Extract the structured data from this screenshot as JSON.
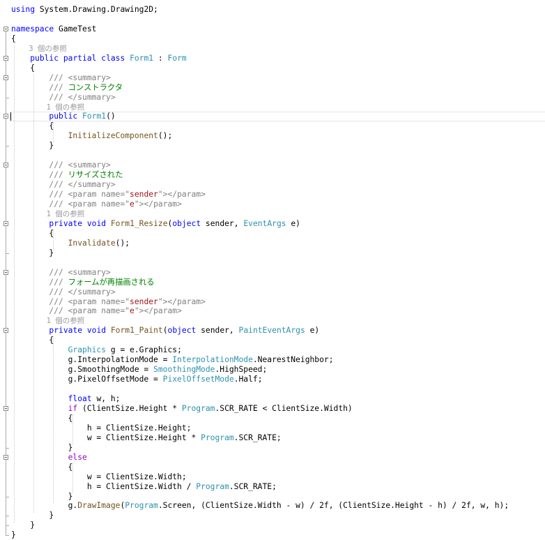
{
  "editor": {
    "lines": [
      [
        {
          "t": "using",
          "c": "kw"
        },
        {
          "t": " System.Drawing.Drawing2D;"
        }
      ],
      [],
      [
        {
          "t": "namespace",
          "c": "kw"
        },
        {
          "t": " GameTest"
        }
      ],
      [
        {
          "t": "{"
        }
      ],
      [
        {
          "t": "    3 個の参照"
        }
      ],
      [
        {
          "t": "    "
        },
        {
          "t": "public",
          "c": "kw"
        },
        {
          "t": " "
        },
        {
          "t": "partial",
          "c": "kw"
        },
        {
          "t": " "
        },
        {
          "t": "class",
          "c": "kw"
        },
        {
          "t": " "
        },
        {
          "t": "Form1",
          "c": "type"
        },
        {
          "t": " : "
        },
        {
          "t": "Form",
          "c": "type"
        }
      ],
      [
        {
          "t": "    {"
        }
      ],
      [
        {
          "t": "        "
        },
        {
          "t": "/// <summary>",
          "c": "xml"
        }
      ],
      [
        {
          "t": "        "
        },
        {
          "t": "///",
          "c": "xml"
        },
        {
          "t": " コンストラクタ",
          "c": "cmt"
        }
      ],
      [
        {
          "t": "        "
        },
        {
          "t": "/// </summary>",
          "c": "xml"
        }
      ],
      [
        {
          "t": "        1 個の参照"
        }
      ],
      [
        {
          "t": "        "
        },
        {
          "t": "public",
          "c": "kw"
        },
        {
          "t": " "
        },
        {
          "t": "Form1",
          "c": "type"
        },
        {
          "t": "()"
        }
      ],
      [
        {
          "t": "        {"
        }
      ],
      [
        {
          "t": "            "
        },
        {
          "t": "InitializeComponent",
          "c": "meth"
        },
        {
          "t": "();"
        }
      ],
      [
        {
          "t": "        }"
        }
      ],
      [],
      [
        {
          "t": "        "
        },
        {
          "t": "/// <summary>",
          "c": "xml"
        }
      ],
      [
        {
          "t": "        "
        },
        {
          "t": "///",
          "c": "xml"
        },
        {
          "t": " リサイズされた",
          "c": "cmt"
        }
      ],
      [
        {
          "t": "        "
        },
        {
          "t": "/// </summary>",
          "c": "xml"
        }
      ],
      [
        {
          "t": "        "
        },
        {
          "t": "/// <param name=\"",
          "c": "xml"
        },
        {
          "t": "sender",
          "c": "str"
        },
        {
          "t": "\"></param>",
          "c": "xml"
        }
      ],
      [
        {
          "t": "        "
        },
        {
          "t": "/// <param name=\"",
          "c": "xml"
        },
        {
          "t": "e",
          "c": "str"
        },
        {
          "t": "\"></param>",
          "c": "xml"
        }
      ],
      [
        {
          "t": "        1 個の参照"
        }
      ],
      [
        {
          "t": "        "
        },
        {
          "t": "private",
          "c": "kw"
        },
        {
          "t": " "
        },
        {
          "t": "void",
          "c": "kw"
        },
        {
          "t": " "
        },
        {
          "t": "Form1_Resize",
          "c": "meth"
        },
        {
          "t": "("
        },
        {
          "t": "object",
          "c": "kw"
        },
        {
          "t": " sender, "
        },
        {
          "t": "EventArgs",
          "c": "type"
        },
        {
          "t": " e)"
        }
      ],
      [
        {
          "t": "        {"
        }
      ],
      [
        {
          "t": "            "
        },
        {
          "t": "Invalidate",
          "c": "meth"
        },
        {
          "t": "();"
        }
      ],
      [
        {
          "t": "        }"
        }
      ],
      [],
      [
        {
          "t": "        "
        },
        {
          "t": "/// <summary>",
          "c": "xml"
        }
      ],
      [
        {
          "t": "        "
        },
        {
          "t": "///",
          "c": "xml"
        },
        {
          "t": " フォームが再描画される",
          "c": "cmt"
        }
      ],
      [
        {
          "t": "        "
        },
        {
          "t": "/// </summary>",
          "c": "xml"
        }
      ],
      [
        {
          "t": "        "
        },
        {
          "t": "/// <param name=\"",
          "c": "xml"
        },
        {
          "t": "sender",
          "c": "str"
        },
        {
          "t": "\"></param>",
          "c": "xml"
        }
      ],
      [
        {
          "t": "        "
        },
        {
          "t": "/// <param name=\"",
          "c": "xml"
        },
        {
          "t": "e",
          "c": "str"
        },
        {
          "t": "\"></param>",
          "c": "xml"
        }
      ],
      [
        {
          "t": "        1 個の参照"
        }
      ],
      [
        {
          "t": "        "
        },
        {
          "t": "private",
          "c": "kw"
        },
        {
          "t": " "
        },
        {
          "t": "void",
          "c": "kw"
        },
        {
          "t": " "
        },
        {
          "t": "Form1_Paint",
          "c": "meth"
        },
        {
          "t": "("
        },
        {
          "t": "object",
          "c": "kw"
        },
        {
          "t": " sender, "
        },
        {
          "t": "PaintEventArgs",
          "c": "type"
        },
        {
          "t": " e)"
        }
      ],
      [
        {
          "t": "        {"
        }
      ],
      [
        {
          "t": "            "
        },
        {
          "t": "Graphics",
          "c": "type"
        },
        {
          "t": " g = e.Graphics;"
        }
      ],
      [
        {
          "t": "            g.InterpolationMode = "
        },
        {
          "t": "InterpolationMode",
          "c": "type"
        },
        {
          "t": ".NearestNeighbor;"
        }
      ],
      [
        {
          "t": "            g.SmoothingMode = "
        },
        {
          "t": "SmoothingMode",
          "c": "type"
        },
        {
          "t": ".HighSpeed;"
        }
      ],
      [
        {
          "t": "            g.PixelOffsetMode = "
        },
        {
          "t": "PixelOffsetMode",
          "c": "type"
        },
        {
          "t": ".Half;"
        }
      ],
      [],
      [
        {
          "t": "            "
        },
        {
          "t": "float",
          "c": "kw"
        },
        {
          "t": " w, h;"
        }
      ],
      [
        {
          "t": "            "
        },
        {
          "t": "if",
          "c": "ctrl"
        },
        {
          "t": " (ClientSize.Height * "
        },
        {
          "t": "Program",
          "c": "type"
        },
        {
          "t": ".SCR_RATE < ClientSize.Width)"
        }
      ],
      [
        {
          "t": "            {"
        }
      ],
      [
        {
          "t": "                h = ClientSize.Height;"
        }
      ],
      [
        {
          "t": "                w = ClientSize.Height * "
        },
        {
          "t": "Program",
          "c": "type"
        },
        {
          "t": ".SCR_RATE;"
        }
      ],
      [
        {
          "t": "            }"
        }
      ],
      [
        {
          "t": "            "
        },
        {
          "t": "else",
          "c": "ctrl"
        }
      ],
      [
        {
          "t": "            {"
        }
      ],
      [
        {
          "t": "                w = ClientSize.Width;"
        }
      ],
      [
        {
          "t": "                h = ClientSize.Width / "
        },
        {
          "t": "Program",
          "c": "type"
        },
        {
          "t": ".SCR_RATE;"
        }
      ],
      [
        {
          "t": "            }"
        }
      ],
      [
        {
          "t": "            g."
        },
        {
          "t": "DrawImage",
          "c": "meth"
        },
        {
          "t": "("
        },
        {
          "t": "Program",
          "c": "type"
        },
        {
          "t": ".Screen, (ClientSize.Width - w) / 2f, (ClientSize.Height - h) / 2f, w, h);"
        }
      ],
      [
        {
          "t": "        }"
        }
      ],
      [
        {
          "t": "    }"
        }
      ],
      [
        {
          "t": "}"
        }
      ]
    ],
    "codelens_lines": [
      4,
      10,
      21,
      32
    ],
    "current_line": 11,
    "fold_lines": [
      2,
      5,
      7,
      11,
      16,
      22,
      27,
      33,
      41,
      46
    ]
  }
}
